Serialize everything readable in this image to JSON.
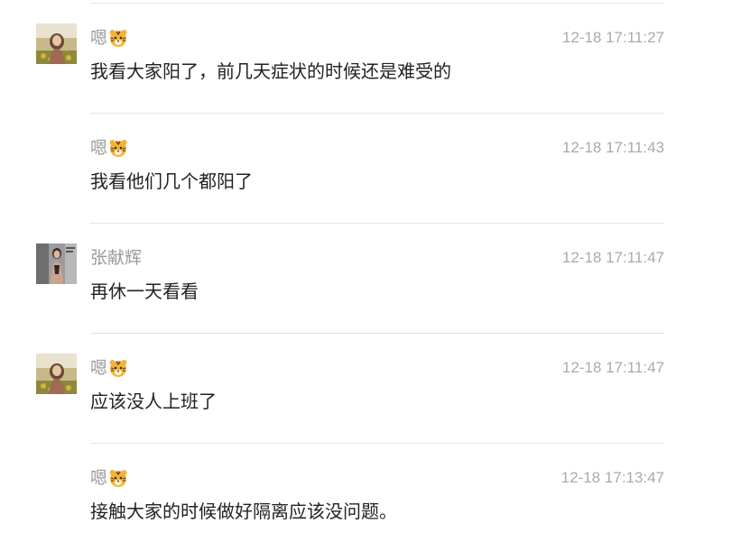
{
  "messages": [
    {
      "sender": "嗯",
      "sender_icon": "tiger-emoji-icon",
      "avatar": "avatar-a",
      "time": "12-18 17:11:27",
      "text": "我看大家阳了，前几天症状的时候还是难受的"
    },
    {
      "sender": "嗯",
      "sender_icon": "tiger-emoji-icon",
      "avatar": "",
      "time": "12-18 17:11:43",
      "text": "我看他们几个都阳了"
    },
    {
      "sender": "张献辉",
      "sender_icon": "",
      "avatar": "avatar-b",
      "time": "12-18 17:11:47",
      "text": "再休一天看看"
    },
    {
      "sender": "嗯",
      "sender_icon": "tiger-emoji-icon",
      "avatar": "avatar-a",
      "time": "12-18 17:11:47",
      "text": "应该没人上班了"
    },
    {
      "sender": "嗯",
      "sender_icon": "tiger-emoji-icon",
      "avatar": "",
      "time": "12-18 17:13:47",
      "text": "接触大家的时候做好隔离应该没问题。"
    }
  ],
  "colors": {
    "sender": "#9a9a9a",
    "time": "#aaaaaa",
    "text": "#222222",
    "divider": "#e6e6e6"
  }
}
